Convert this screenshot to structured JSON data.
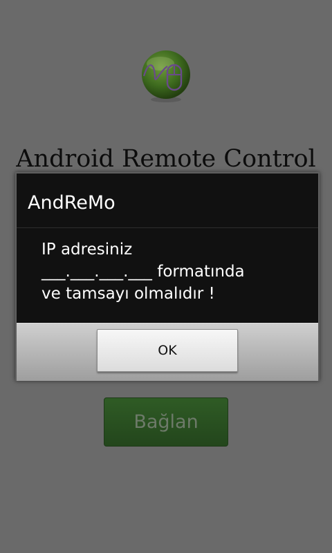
{
  "app": {
    "icon": "computer-mouse-icon",
    "title": "Android Remote Control",
    "connect_label": "Bağlan",
    "accent_color": "#2f5b25"
  },
  "dialog": {
    "title": "AndReMo",
    "message_lines": [
      "IP adresiniz",
      "___.___.___.___ formatında",
      "ve tamsayı olmalıdır !"
    ],
    "ok_label": "OK"
  }
}
